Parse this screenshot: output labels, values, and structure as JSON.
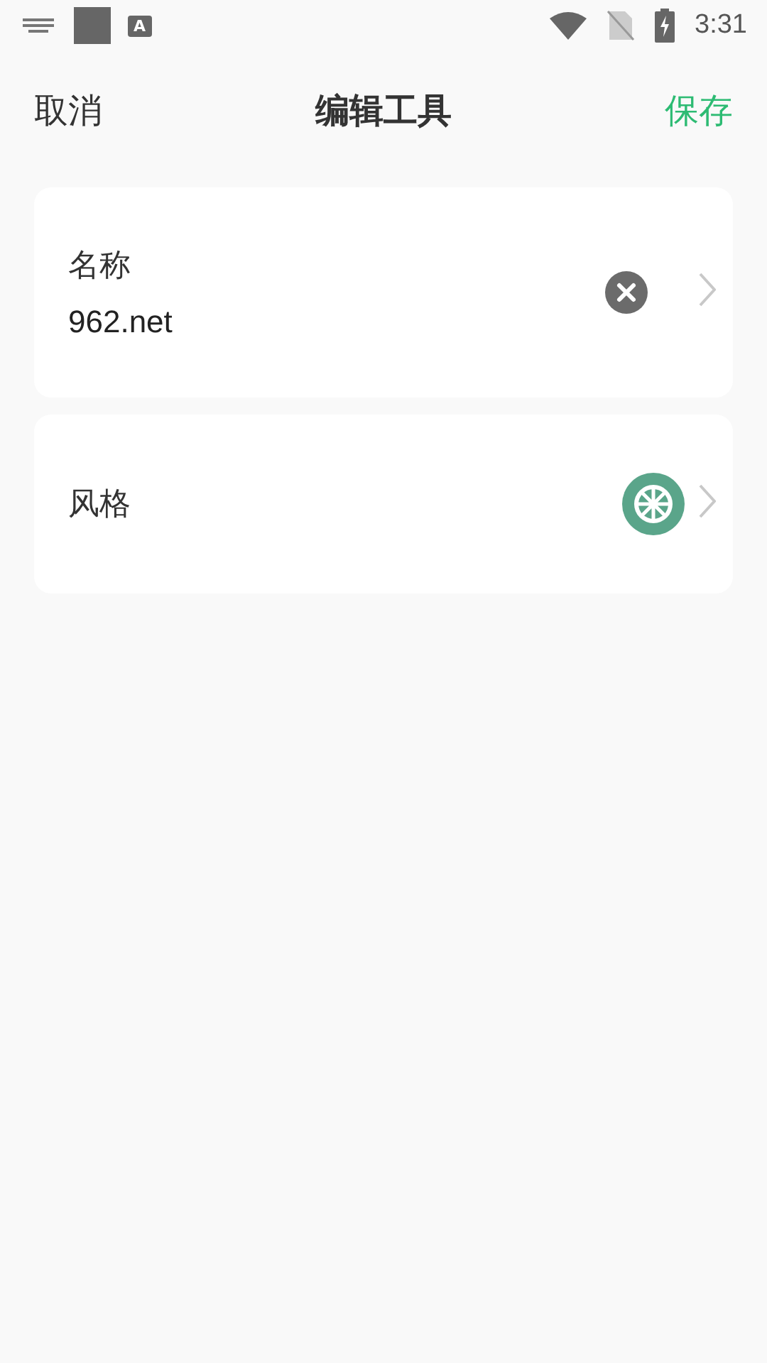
{
  "status_bar": {
    "app_badge": "A",
    "time": "3:31"
  },
  "header": {
    "cancel": "取消",
    "title": "编辑工具",
    "save": "保存"
  },
  "name_field": {
    "label": "名称",
    "value": "962.net"
  },
  "style_row": {
    "label": "风格",
    "color": "#5aa58a"
  }
}
